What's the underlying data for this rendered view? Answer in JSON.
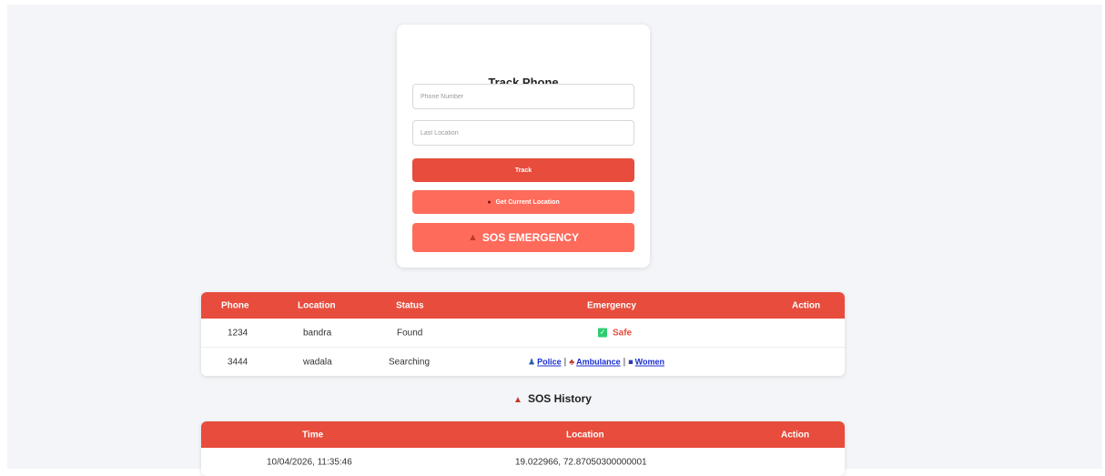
{
  "form": {
    "title": "Track Phone",
    "phone_placeholder": "Phone Number",
    "phone_value": "",
    "location_placeholder": "Last Location",
    "location_value": "",
    "track_label": "Track",
    "current_location_label": "Get Current Location",
    "current_location_icon": "pin-icon",
    "sos_label": "SOS EMERGENCY",
    "sos_icon": "siren-icon"
  },
  "phones_table": {
    "headers": [
      "Phone",
      "Location",
      "Status",
      "Emergency",
      "Action"
    ],
    "rows": [
      {
        "phone": "1234",
        "location": "bandra",
        "status": "Found",
        "emergency_safe": "Safe"
      },
      {
        "phone": "3444",
        "location": "wadala",
        "status": "Searching",
        "police": "Police",
        "ambulance": "Ambulance",
        "women": "Women",
        "separator": "|"
      }
    ]
  },
  "sos_history": {
    "title": "SOS History",
    "headers": [
      "Time",
      "Location",
      "Action"
    ],
    "rows": [
      {
        "time": "10/04/2026, 11:35:46",
        "location": "19.022966, 72.87050300000001"
      }
    ]
  },
  "colors": {
    "primary": "#e74c3c",
    "secondary": "#ff6b5b",
    "background": "#f3f5f8",
    "link": "#1a2fd0",
    "safe_check": "#2ecc71"
  }
}
